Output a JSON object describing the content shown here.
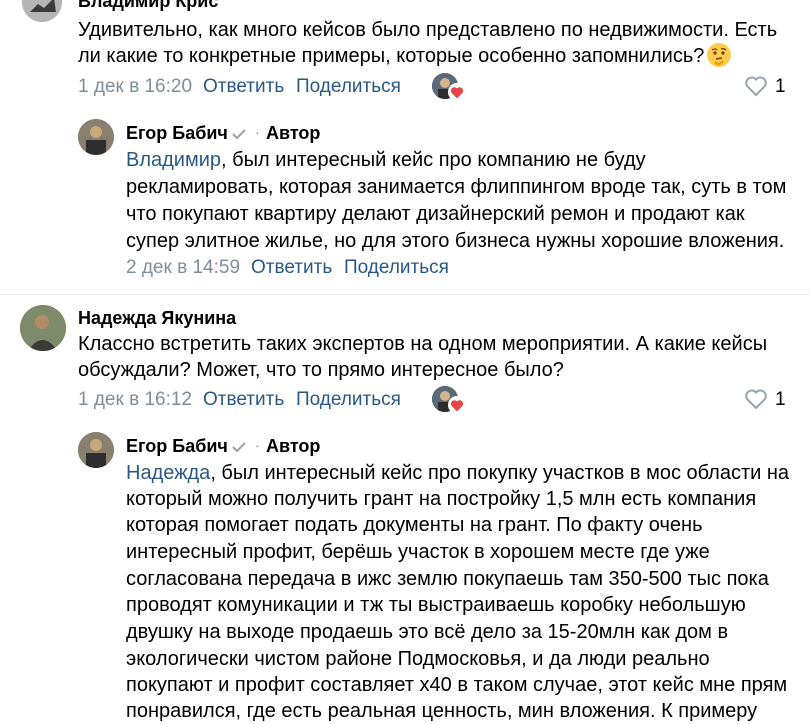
{
  "comments": [
    {
      "author": "Владимир Крис",
      "text_lines": [
        "Удивительно, как много кейсов было представлено по недвижимости. Есть",
        "ли какие то конкретные примеры, которые особенно запомнились?"
      ],
      "emoji": "thinking-face",
      "date": "1 дек в 16:20",
      "reply_label": "Ответить",
      "share_label": "Поделиться",
      "like_count": "1",
      "reply": {
        "author": "Егор Бабич",
        "badge": "Автор",
        "mention": "Владимир",
        "text_lines": [
          ", был интересный кейс про компанию не буду",
          "рекламировать, которая занимается флиппингом вроде так, суть в том",
          "что покупают квартиру делают дизайнерский ремон и продают как",
          "супер элитное жилье, но для этого бизнеса нужны хорошие вложения."
        ],
        "date": "2 дек в 14:59",
        "reply_label": "Ответить",
        "share_label": "Поделиться"
      }
    },
    {
      "author": "Надежда Якунина",
      "text_lines": [
        "Классно встретить таких экспертов на одном мероприятии. А какие кейсы",
        "обсуждали? Может, что то прямо интересное было?"
      ],
      "date": "1 дек в 16:12",
      "reply_label": "Ответить",
      "share_label": "Поделиться",
      "like_count": "1",
      "reply": {
        "author": "Егор Бабич",
        "badge": "Автор",
        "mention": "Надежда",
        "text_lines": [
          ", был интересный кейс про покупку участков в мос области на",
          "который можно получить грант на постройку 1,5 млн есть компания",
          "которая помогает подать документы на грант. По факту очень",
          "интересный профит, берёшь участок в хорошем месте где уже",
          "согласована передача в ижс землю покупаешь там 350-500 тыс пока",
          "проводят комуникации и тж ты выстраиваешь коробку небольшую",
          "двушку на выходе продаешь это всё дело за 15-20млн как дом в",
          "экологически чистом районе Подмосковья, и да люди реально",
          "покупают и профит составляет х40 в таком случае, этот кейс мне прям",
          "понравился, где есть реальная ценность, мин вложения. К примеру"
        ]
      }
    }
  ],
  "colors": {
    "link": "#2a5885",
    "meta": "#818c99",
    "heart": "#e64646",
    "check": "#99a2ad"
  }
}
